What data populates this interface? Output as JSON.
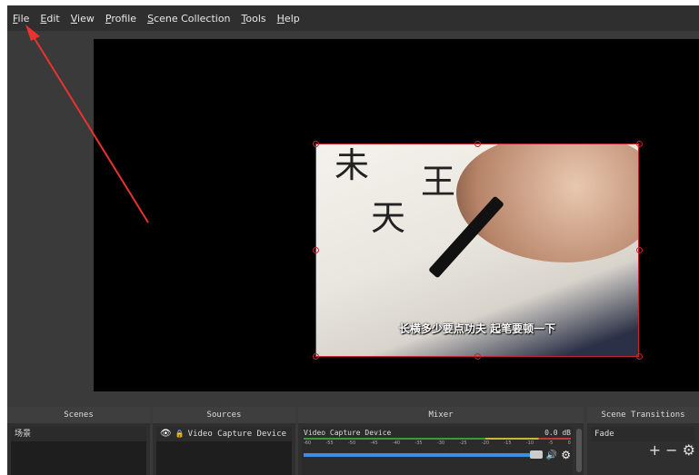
{
  "menu": [
    "File",
    "Edit",
    "View",
    "Profile",
    "Scene Collection",
    "Tools",
    "Help"
  ],
  "menu_mnemonic": [
    "F",
    "E",
    "V",
    "P",
    "S",
    "T",
    "H"
  ],
  "preview": {
    "subtitle": "长横多少要点功夫 起笔要顿一下"
  },
  "docks": {
    "scenes": {
      "title": "Scenes",
      "items": [
        "场景"
      ]
    },
    "sources": {
      "title": "Sources",
      "items": [
        "Video Capture Device"
      ]
    },
    "mixer": {
      "title": "Mixer",
      "channel": "Video Capture Device",
      "level": "0.0 dB",
      "ticks": [
        "-60",
        "-55",
        "-50",
        "-45",
        "-40",
        "-35",
        "-30",
        "-25",
        "-20",
        "-15",
        "-10",
        "-5",
        "0"
      ],
      "volume": 0.95
    },
    "transitions": {
      "title": "Scene Transitions",
      "selected": "Fade",
      "add": "+",
      "remove": "−"
    }
  },
  "colors": {
    "accent": "#c0282f",
    "slider": "#3a8ee6",
    "arrow": "#e8332e"
  }
}
